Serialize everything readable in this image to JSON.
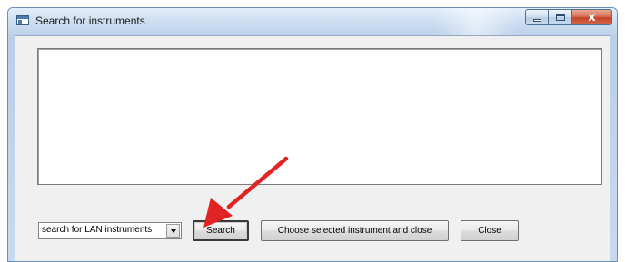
{
  "window": {
    "title": "Search for instruments",
    "icon": "app-window-icon",
    "caption_buttons": {
      "minimize_icon": "minimize-icon",
      "maximize_icon": "maximize-icon",
      "close_icon": "close-x-icon",
      "close_glyph": "x"
    }
  },
  "results": {
    "items": []
  },
  "controls": {
    "search_mode": "search for LAN instruments",
    "search_label": "Search",
    "choose_label": "Choose selected instrument and close",
    "close_label": "Close"
  },
  "annotation": {
    "pointer_icon": "red-arrow-pointer",
    "color": "#e02424"
  }
}
